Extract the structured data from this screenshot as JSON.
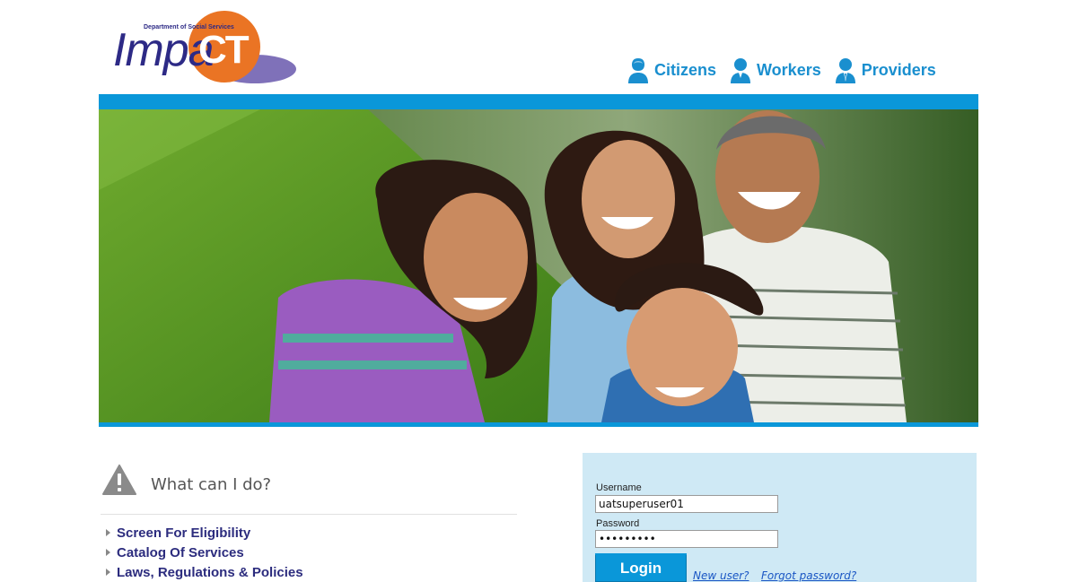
{
  "logo": {
    "department": "Department of Social Services",
    "name_part1": "Impa",
    "name_part2": "CT"
  },
  "topnav": [
    {
      "label": "Citizens",
      "icon": "citizen-icon"
    },
    {
      "label": "Workers",
      "icon": "worker-icon"
    },
    {
      "label": "Providers",
      "icon": "provider-icon"
    }
  ],
  "colors": {
    "brand_blue": "#0a97d9",
    "logo_orange": "#ea7424",
    "logo_purple": "#2d2a86",
    "panel_bg": "#cfe9f5",
    "link_navy": "#2c2c7e"
  },
  "whatcanido": {
    "icon": "warning-icon",
    "title": "What can I do?",
    "links": [
      "Screen For Eligibility",
      "Catalog Of Services",
      "Laws, Regulations & Policies"
    ]
  },
  "login": {
    "username_label": "Username",
    "username_value": "uatsuperuser01",
    "password_label": "Password",
    "password_value": "•••••••••",
    "button_label": "Login",
    "new_user": "New user?",
    "forgot_password": "Forgot password?"
  }
}
